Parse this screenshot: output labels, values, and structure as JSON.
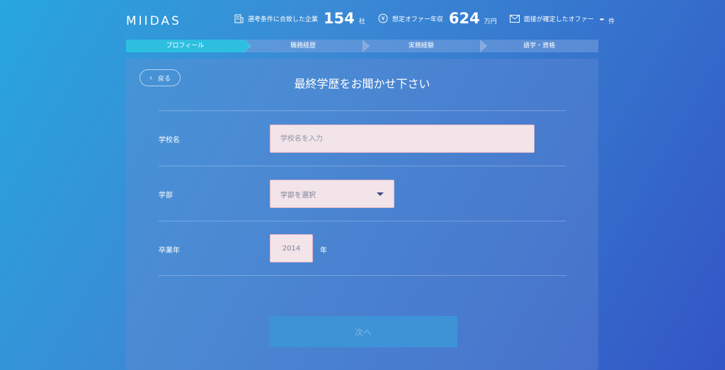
{
  "brand": {
    "logo_text": "MIIDAS"
  },
  "stats": [
    {
      "icon": "building-icon",
      "label": "選考条件に合致した企業",
      "value": "154",
      "unit": "社"
    },
    {
      "icon": "yen-icon",
      "label": "想定オファー年収",
      "value": "624",
      "unit": "万円"
    },
    {
      "icon": "mail-icon",
      "label": "面接が確定したオファー",
      "value": "-",
      "unit": "件"
    }
  ],
  "steps": [
    {
      "label": "プロフィール",
      "active": true
    },
    {
      "label": "職務経歴",
      "active": false
    },
    {
      "label": "実務経験",
      "active": false
    },
    {
      "label": "語学・資格",
      "active": false
    }
  ],
  "form": {
    "back_label": "戻る",
    "title": "最終学歴をお聞かせ下さい",
    "school": {
      "label": "学校名",
      "placeholder": "学校名を入力",
      "value": ""
    },
    "faculty": {
      "label": "学部",
      "selected": "学部を選択"
    },
    "graduation": {
      "label": "卒業年",
      "value": "2014",
      "unit": "年"
    },
    "next_label": "次へ"
  },
  "colors": {
    "active_step": "#2ebfe0",
    "input_bg": "#f2e4e8",
    "input_border": "#e3b7c4",
    "next_button": "#3d93d6"
  }
}
